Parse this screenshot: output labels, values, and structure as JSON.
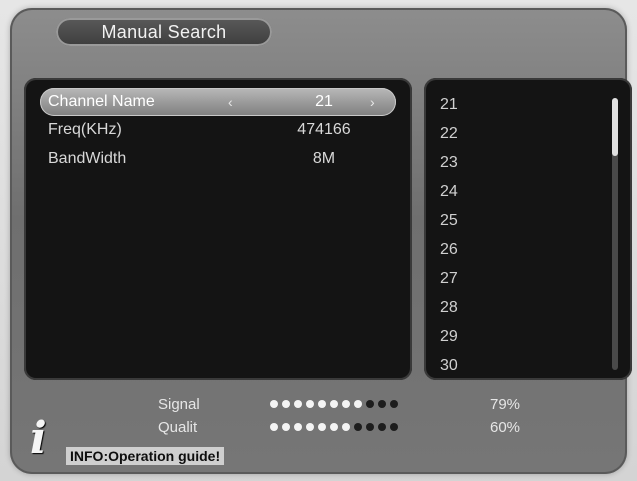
{
  "title": "Manual Search",
  "fields": [
    {
      "label": "Channel Name",
      "value": "21",
      "left_arrow": "‹",
      "right_arrow": "›"
    },
    {
      "label": "Freq(KHz)",
      "value": "474166"
    },
    {
      "label": "BandWidth",
      "value": "8M"
    }
  ],
  "channel_list": [
    "21",
    "22",
    "23",
    "24",
    "25",
    "26",
    "27",
    "28",
    "29",
    "30"
  ],
  "signal": {
    "label": "Signal",
    "value": "79%",
    "level_fraction": 0.79,
    "dots_total": 11,
    "dots_on": 8
  },
  "quality": {
    "label": "Qualit",
    "value": "60%",
    "level_fraction": 0.6,
    "dots_total": 11,
    "dots_on": 7
  },
  "info": {
    "icon": "info-icon",
    "glyph": "i",
    "text": "INFO:Operation guide!"
  },
  "colors": {
    "panel": "#141414",
    "frame": "#7a7a7a",
    "highlight": "#a8a8a8"
  }
}
